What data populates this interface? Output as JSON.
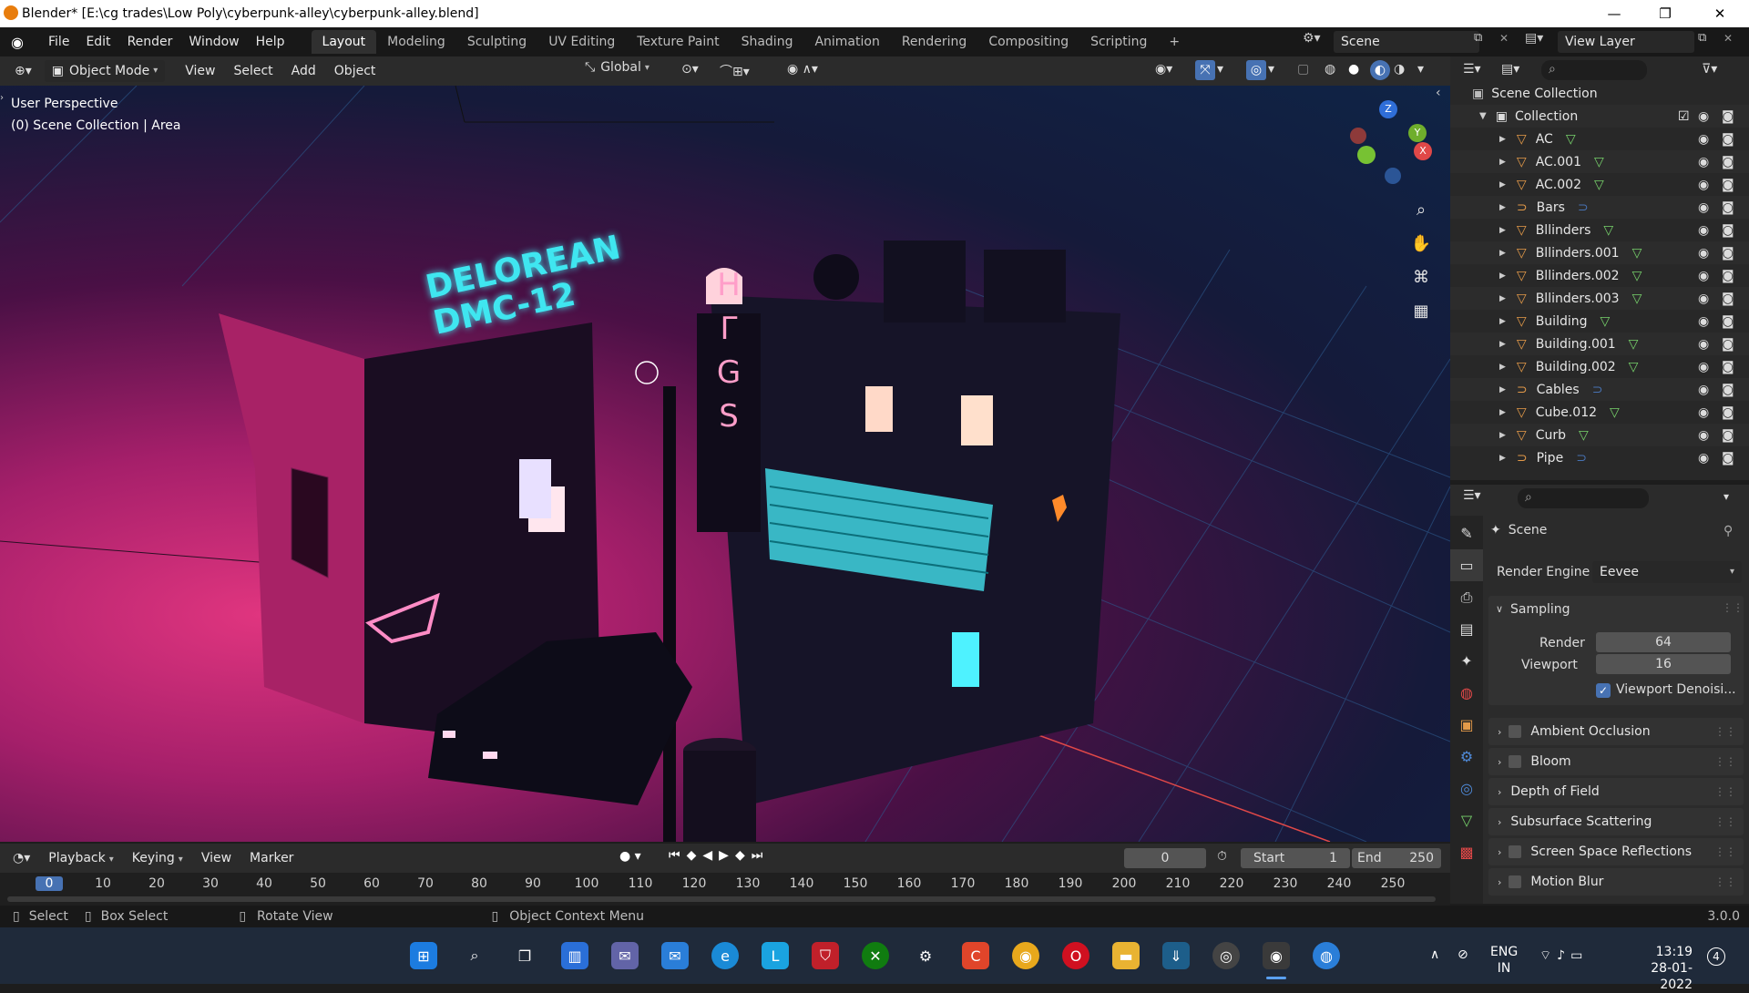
{
  "titlebar": {
    "title": "Blender* [E:\\cg trades\\Low Poly\\cyberpunk-alley\\cyberpunk-alley.blend]",
    "minimize": "—",
    "maximize": "❐",
    "close": "✕"
  },
  "menubar": {
    "menus": [
      "File",
      "Edit",
      "Render",
      "Window",
      "Help"
    ],
    "workspaces": [
      "Layout",
      "Modeling",
      "Sculpting",
      "UV Editing",
      "Texture Paint",
      "Shading",
      "Animation",
      "Rendering",
      "Compositing",
      "Scripting"
    ],
    "active_workspace": "Layout",
    "add_workspace": "+",
    "scene": "Scene",
    "view_layer": "View Layer"
  },
  "viewport_header": {
    "mode": "Object Mode",
    "menus": [
      "View",
      "Select",
      "Add",
      "Object"
    ],
    "transform_orientation": "Global"
  },
  "viewport": {
    "perspective_label": "User Perspective",
    "collection_label": "(0) Scene Collection | Area",
    "sign_text_line1": "DELOREAN",
    "sign_text_line2": "DMC-12",
    "vertical_sign": [
      "H",
      "Γ",
      "G",
      "S"
    ],
    "gizmo": {
      "x": "X",
      "y": "Y",
      "z": "Z"
    }
  },
  "outliner": {
    "search_placeholder": "",
    "root": "Scene Collection",
    "collection": "Collection",
    "items": [
      {
        "name": "AC",
        "type": "mesh"
      },
      {
        "name": "AC.001",
        "type": "mesh"
      },
      {
        "name": "AC.002",
        "type": "mesh"
      },
      {
        "name": "Bars",
        "type": "curve"
      },
      {
        "name": "Bllinders",
        "type": "mesh"
      },
      {
        "name": "Bllinders.001",
        "type": "mesh"
      },
      {
        "name": "Bllinders.002",
        "type": "mesh"
      },
      {
        "name": "Bllinders.003",
        "type": "mesh"
      },
      {
        "name": "Building",
        "type": "mesh"
      },
      {
        "name": "Building.001",
        "type": "mesh"
      },
      {
        "name": "Building.002",
        "type": "mesh"
      },
      {
        "name": "Cables",
        "type": "curve"
      },
      {
        "name": "Cube.012",
        "type": "mesh"
      },
      {
        "name": "Curb",
        "type": "mesh"
      },
      {
        "name": "Pipe",
        "type": "curve"
      }
    ]
  },
  "properties": {
    "context": "Scene",
    "render_engine_label": "Render Engine",
    "render_engine": "Eevee",
    "sampling": {
      "title": "Sampling",
      "render_label": "Render",
      "render_value": "64",
      "viewport_label": "Viewport",
      "viewport_value": "16",
      "denoise_label": "Viewport Denoisi...",
      "denoise_checked": true
    },
    "panels": [
      "Ambient Occlusion",
      "Bloom",
      "Depth of Field",
      "Subsurface Scattering",
      "Screen Space Reflections",
      "Motion Blur"
    ]
  },
  "timeline": {
    "menus": [
      "Playback",
      "Keying",
      "View",
      "Marker"
    ],
    "current_frame": "0",
    "start_label": "Start",
    "start": "1",
    "end_label": "End",
    "end": "250",
    "ruler": [
      "0",
      "10",
      "20",
      "30",
      "40",
      "50",
      "60",
      "70",
      "80",
      "90",
      "100",
      "110",
      "120",
      "130",
      "140",
      "150",
      "160",
      "170",
      "180",
      "190",
      "200",
      "210",
      "220",
      "230",
      "240",
      "250"
    ]
  },
  "statusbar": {
    "select": "Select",
    "box_select": "Box Select",
    "rotate_view": "Rotate View",
    "context_menu": "Object Context Menu",
    "version": "3.0.0"
  },
  "taskbar": {
    "language": "ENG",
    "region": "IN",
    "time": "13:19",
    "date": "28-01-2022",
    "notifications": "4"
  },
  "colors": {
    "accent": "#4772b3",
    "neon_cyan": "#3fe6f0",
    "neon_pink": "#ff6fb1",
    "mesh_icon": "#e49a49",
    "green_data": "#77d26b"
  }
}
